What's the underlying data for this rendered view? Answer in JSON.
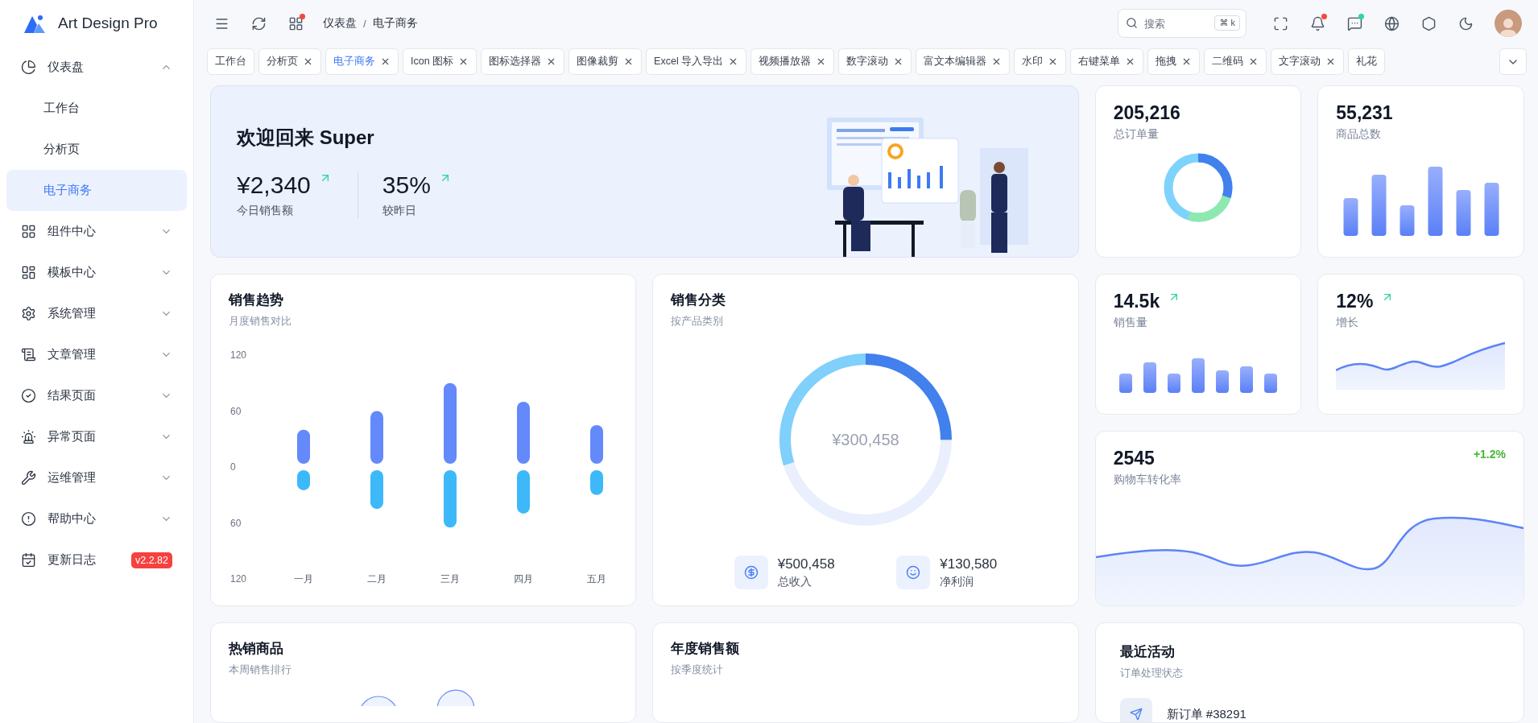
{
  "sidebar": {
    "logo_text": "Art Design Pro",
    "items": [
      {
        "label": "仪表盘",
        "selected": false,
        "expanded": true,
        "children": [
          {
            "label": "工作台",
            "selected": false
          },
          {
            "label": "分析页",
            "selected": false
          },
          {
            "label": "电子商务",
            "selected": true
          }
        ]
      },
      {
        "label": "组件中心",
        "selected": false,
        "expanded": false
      },
      {
        "label": "模板中心",
        "selected": false,
        "expanded": false
      },
      {
        "label": "系统管理",
        "selected": false,
        "expanded": false
      },
      {
        "label": "文章管理",
        "selected": false,
        "expanded": false
      },
      {
        "label": "结果页面",
        "selected": false,
        "expanded": false
      },
      {
        "label": "异常页面",
        "selected": false,
        "expanded": false
      },
      {
        "label": "运维管理",
        "selected": false,
        "expanded": false
      },
      {
        "label": "帮助中心",
        "selected": false,
        "expanded": false
      },
      {
        "label": "更新日志",
        "selected": false,
        "badge": "v2.2.82"
      }
    ]
  },
  "header": {
    "tools_left": [
      {
        "dot": false
      },
      {
        "dot": false
      },
      {
        "dot": true,
        "color": "#f5483b"
      }
    ],
    "breadcrumb": {
      "items": [
        "仪表盘",
        "电子商务"
      ],
      "separator": "/"
    },
    "search": {
      "placeholder": "搜索",
      "shortcut": "⌘ k"
    },
    "tools_right": [
      {
        "dot": false
      },
      {
        "dot": true,
        "color": "#f5483b"
      },
      {
        "dot": true,
        "color": "#2dd4a8"
      },
      {
        "dot": false
      },
      {
        "dot": false
      },
      {
        "dot": false
      }
    ]
  },
  "tabs": [
    {
      "label": "工作台",
      "selected": false,
      "closable": false
    },
    {
      "label": "分析页",
      "selected": false,
      "closable": true
    },
    {
      "label": "电子商务",
      "selected": true,
      "closable": true
    },
    {
      "label": "Icon 图标",
      "selected": false,
      "closable": true
    },
    {
      "label": "图标选择器",
      "selected": false,
      "closable": true
    },
    {
      "label": "图像裁剪",
      "selected": false,
      "closable": true
    },
    {
      "label": "Excel 导入导出",
      "selected": false,
      "closable": true
    },
    {
      "label": "视频播放器",
      "selected": false,
      "closable": true
    },
    {
      "label": "数字滚动",
      "selected": false,
      "closable": true
    },
    {
      "label": "富文本编辑器",
      "selected": false,
      "closable": true
    },
    {
      "label": "水印",
      "selected": false,
      "closable": true
    },
    {
      "label": "右键菜单",
      "selected": false,
      "closable": true
    },
    {
      "label": "拖拽",
      "selected": false,
      "closable": true
    },
    {
      "label": "二维码",
      "selected": false,
      "closable": true
    },
    {
      "label": "文字滚动",
      "selected": false,
      "closable": true
    },
    {
      "label": "礼花",
      "selected": false,
      "closable": false
    }
  ],
  "welcome": {
    "title": "欢迎回来 Super",
    "stats": [
      {
        "value": "¥2,340",
        "label": "今日销售额",
        "trend_up": true
      },
      {
        "value": "35%",
        "label": "较昨日",
        "trend_up": true
      }
    ]
  },
  "stat_cards": [
    {
      "kind": "donut",
      "value": "205,216",
      "label": "总订单量"
    },
    {
      "kind": "bars",
      "value": "55,231",
      "label": "商品总数"
    },
    {
      "kind": "mini-bars",
      "value": "14.5k",
      "label": "销售量",
      "trend_up": true
    },
    {
      "kind": "line",
      "value": "12%",
      "label": "增长",
      "trend_up": true
    }
  ],
  "conversion": {
    "value": "2545",
    "label": "购物车转化率",
    "change": "+1.2%"
  },
  "sales_trend": {
    "title": "销售趋势",
    "subtitle": "月度销售对比",
    "chart_data": {
      "type": "bar",
      "stacked": true,
      "categories": [
        "一月",
        "二月",
        "三月",
        "四月",
        "五月"
      ],
      "series": [
        {
          "color": "#6489fb",
          "values": [
            40,
            60,
            90,
            70,
            45
          ]
        },
        {
          "color": "#3db9f9",
          "values": [
            -25,
            -45,
            -65,
            -50,
            -30
          ]
        }
      ],
      "ylim": [
        -120,
        120
      ],
      "yticks": [
        {
          "value": 120,
          "label": "120"
        },
        {
          "value": 60,
          "label": "60"
        },
        {
          "value": 0,
          "label": "0"
        },
        {
          "value": -60,
          "label": "60"
        },
        {
          "value": -120,
          "label": "120"
        }
      ]
    }
  },
  "sales_category": {
    "title": "销售分类",
    "subtitle": "按产品类别",
    "total": "¥300,458",
    "metrics": [
      {
        "value": "¥500,458",
        "label": "总收入"
      },
      {
        "value": "¥130,580",
        "label": "净利润"
      }
    ]
  },
  "hot_products": {
    "title": "热销商品",
    "subtitle": "本周销售排行"
  },
  "annual_sales": {
    "title": "年度销售额",
    "subtitle": "按季度统计"
  },
  "recent_activity": {
    "title": "最近活动",
    "subtitle": "订单处理状态",
    "items": [
      {
        "title": "新订单 #38291"
      }
    ]
  }
}
